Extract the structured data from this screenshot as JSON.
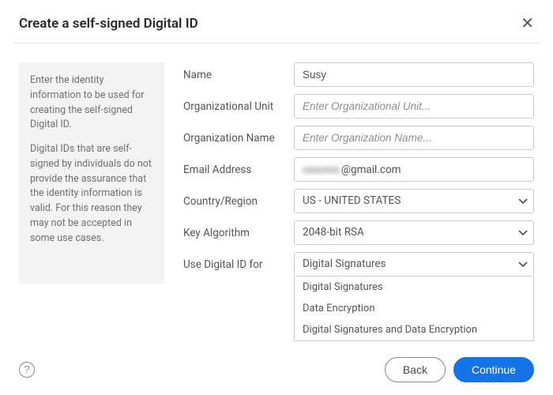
{
  "header": {
    "title": "Create a self-signed Digital ID",
    "close_glyph": "✕"
  },
  "info": {
    "p1": "Enter the identity information to be used for creating the self-signed Digital ID.",
    "p2": "Digital IDs that are self-signed by individuals do not provide the assurance that the identity information is valid. For this reason they may not be accepted in some use cases."
  },
  "form": {
    "name": {
      "label": "Name",
      "value": "Susy"
    },
    "org_unit": {
      "label": "Organizational Unit",
      "placeholder": "Enter Organizational Unit..."
    },
    "org_name": {
      "label": "Organization Name",
      "placeholder": "Enter Organization Name..."
    },
    "email": {
      "label": "Email Address",
      "value_obscured": "xxxxxxx",
      "value_suffix": "@gmail.com"
    },
    "country": {
      "label": "Country/Region",
      "value": "US - UNITED STATES"
    },
    "key_algo": {
      "label": "Key Algorithm",
      "value": "2048-bit RSA"
    },
    "use_for": {
      "label": "Use Digital ID for",
      "value": "Digital Signatures",
      "options": [
        "Digital Signatures",
        "Data Encryption",
        "Digital Signatures and Data Encryption"
      ]
    }
  },
  "footer": {
    "help_glyph": "?",
    "back": "Back",
    "continue": "Continue"
  }
}
